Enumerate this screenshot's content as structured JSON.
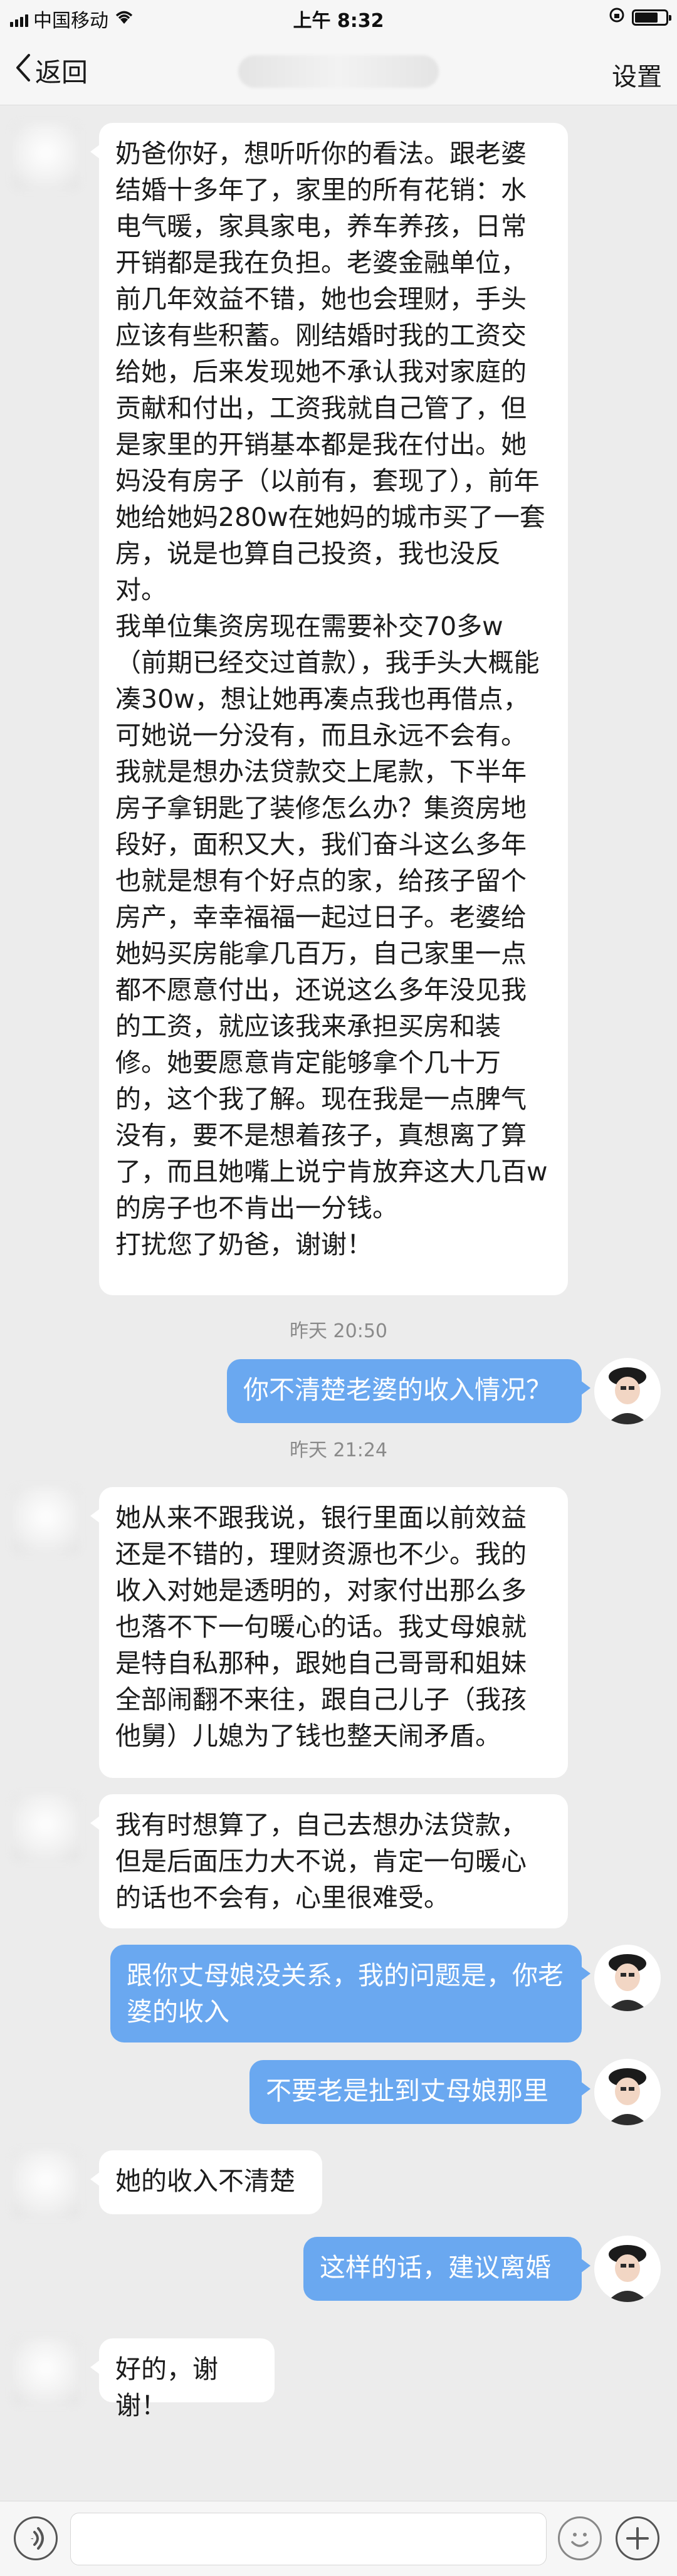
{
  "status_bar": {
    "carrier": "中国移动",
    "time": "上午 8:32",
    "battery_level": 0.75,
    "icons": [
      "signal-icon",
      "wifi-icon",
      "orientation-lock-icon",
      "battery-icon"
    ]
  },
  "nav": {
    "back_label": "返回",
    "settings_label": "设置",
    "title": "",
    "icons": [
      "chevron-left-icon"
    ]
  },
  "messages": [
    {
      "side": "left",
      "text": "奶爸你好，想听听你的看法。跟老婆结婚十多年了，家里的所有花销：水电气暖，家具家电，养车养孩，日常开销都是我在负担。老婆金融单位，前几年效益不错，她也会理财，手头应该有些积蓄。刚结婚时我的工资交给她，后来发现她不承认我对家庭的贡献和付出，工资我就自己管了，但是家里的开销基本都是我在付出。她妈没有房子（以前有，套现了），前年她给她妈280w在她妈的城市买了一套房，说是也算自己投资，我也没反对。\n我单位集资房现在需要补交70多w（前期已经交过首款），我手头大概能凑30w，想让她再凑点我也再借点，可她说一分没有，而且永远不会有。我就是想办法贷款交上尾款，下半年房子拿钥匙了装修怎么办？集资房地段好，面积又大，我们奋斗这么多年也就是想有个好点的家，给孩子留个房产，幸幸福福一起过日子。老婆给她妈买房能拿几百万，自己家里一点都不愿意付出，还说这么多年没见我的工资，就应该我来承担买房和装修。她要愿意肯定能够拿个几十万的，这个我了解。现在我是一点脾气没有，要不是想着孩子，真想离了算了，而且她嘴上说宁肯放弃这大几百w的房子也不肯出一分钱。\n打扰您了奶爸，谢谢！"
    },
    {
      "side": "time",
      "text": "昨天 20:50"
    },
    {
      "side": "right",
      "text": "你不清楚老婆的收入情况？"
    },
    {
      "side": "time",
      "text": "昨天 21:24"
    },
    {
      "side": "left",
      "text": "她从来不跟我说，银行里面以前效益还是不错的，理财资源也不少。我的收入对她是透明的，对家付出那么多也落不下一句暖心的话。我丈母娘就是特自私那种，跟她自己哥哥和姐妹全部闹翻不来往，跟自己儿子（我孩他舅）儿媳为了钱也整天闹矛盾。"
    },
    {
      "side": "left",
      "text": "我有时想算了，自己去想办法贷款，但是后面压力大不说，肯定一句暖心的话也不会有，心里很难受。"
    },
    {
      "side": "right",
      "text": "跟你丈母娘没关系，我的问题是，你老婆的收入"
    },
    {
      "side": "right",
      "text": "不要老是扯到丈母娘那里"
    },
    {
      "side": "left",
      "text": "她的收入不清楚"
    },
    {
      "side": "right",
      "text": "这样的话，建议离婚"
    },
    {
      "side": "left",
      "text": "好的，谢谢！"
    }
  ],
  "input_bar": {
    "placeholder": "",
    "icons": [
      "voice-icon",
      "emoji-icon",
      "plus-icon"
    ]
  },
  "colors": {
    "background": "#ececec",
    "bubble_left": "#ffffff",
    "bubble_right": "#6aa8f0",
    "timestamp": "#8a8a8a"
  }
}
